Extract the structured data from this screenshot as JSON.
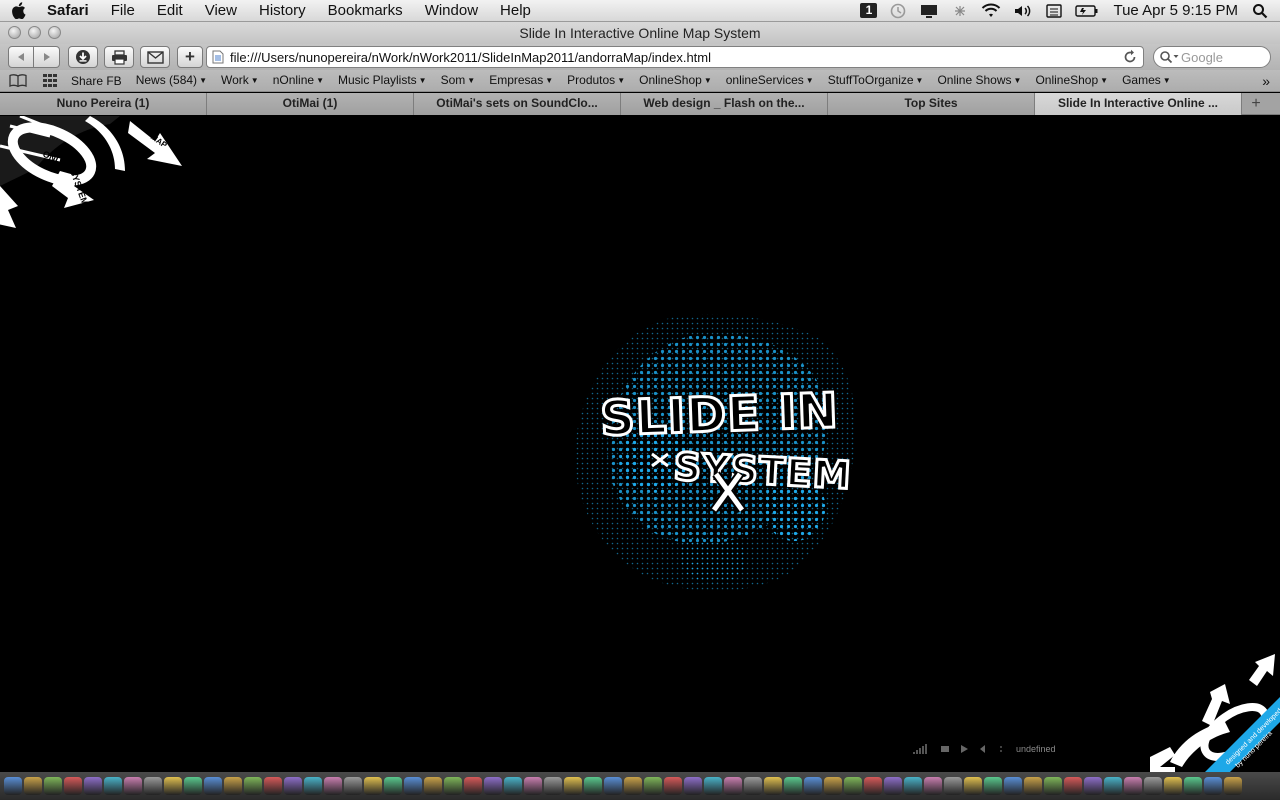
{
  "menubar": {
    "items": [
      "Safari",
      "File",
      "Edit",
      "View",
      "History",
      "Bookmarks",
      "Window",
      "Help"
    ],
    "status_icons": [
      "calendar-badge-icon",
      "time-machine-icon",
      "display-icon",
      "bluetooth-icon",
      "wifi-icon",
      "volume-icon",
      "input-menu-icon",
      "battery-icon"
    ],
    "calendar_badge": "1",
    "clock": "Tue Apr 5  9:15 PM"
  },
  "window": {
    "title": "Slide In Interactive Online Map System"
  },
  "toolbar": {
    "url": "file:///Users/nunopereira/nWork/nWork2011/SlideInMap2011/andorraMap/index.html",
    "search_placeholder": "Google",
    "add_label": "+"
  },
  "bookmarks": {
    "items": [
      {
        "label": "Share FB",
        "menu": false
      },
      {
        "label": "News (584)",
        "menu": true
      },
      {
        "label": "Work",
        "menu": true
      },
      {
        "label": "nOnline",
        "menu": true
      },
      {
        "label": "Music Playlists",
        "menu": true
      },
      {
        "label": "Som",
        "menu": true
      },
      {
        "label": "Empresas",
        "menu": true
      },
      {
        "label": "Produtos",
        "menu": true
      },
      {
        "label": "OnlineShop",
        "menu": true
      },
      {
        "label": "onlineServices",
        "menu": true
      },
      {
        "label": "StuffToOrganize",
        "menu": true
      },
      {
        "label": "Online Shows",
        "menu": true
      },
      {
        "label": "OnlineShop",
        "menu": true
      },
      {
        "label": "Games",
        "menu": true
      }
    ],
    "overflow": "»"
  },
  "tabs": [
    {
      "label": "Nuno Pereira (1)",
      "active": false
    },
    {
      "label": "OtiMai (1)",
      "active": false
    },
    {
      "label": "OtiMai's sets on SoundClo...",
      "active": false
    },
    {
      "label": "Web design _ Flash on the...",
      "active": false
    },
    {
      "label": "Top Sites",
      "active": false
    },
    {
      "label": "Slide In Interactive Online ...",
      "active": true
    }
  ],
  "new_tab_label": "+",
  "content": {
    "logo_line1": "SLIDE IN",
    "logo_line2": "SYSTEM",
    "corner_tl_words": [
      "ONLINE",
      "SYSTEM",
      "MAP"
    ],
    "corner_br_words": [
      "designed and developed",
      "by nuno pereira"
    ],
    "player_status": "undefined",
    "accent_color": "#1ea8e8",
    "bg_color": "#000000"
  }
}
